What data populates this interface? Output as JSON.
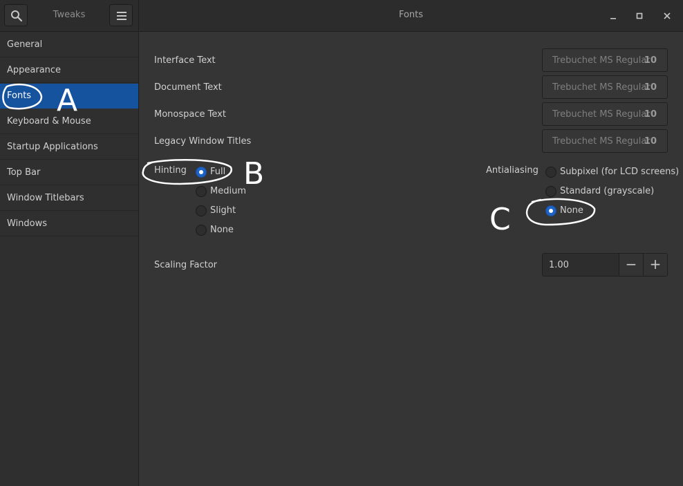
{
  "header": {
    "app_title": "Tweaks",
    "page_title": "Fonts",
    "search_icon": "search-icon",
    "menu_icon": "hamburger-menu-icon",
    "window_controls": [
      "minimize-icon",
      "maximize-icon",
      "close-icon"
    ]
  },
  "sidebar": {
    "items": [
      {
        "label": "General"
      },
      {
        "label": "Appearance"
      },
      {
        "label": "Fonts",
        "selected": true
      },
      {
        "label": "Keyboard & Mouse"
      },
      {
        "label": "Startup Applications"
      },
      {
        "label": "Top Bar"
      },
      {
        "label": "Window Titlebars"
      },
      {
        "label": "Windows"
      }
    ]
  },
  "fonts": {
    "interface": {
      "label": "Interface Text",
      "font": "Trebuchet MS Regular",
      "size": "10"
    },
    "document": {
      "label": "Document Text",
      "font": "Trebuchet MS Regular",
      "size": "10"
    },
    "monospace": {
      "label": "Monospace Text",
      "font": "Trebuchet MS Regular",
      "size": "10"
    },
    "legacy": {
      "label": "Legacy Window Titles",
      "font": "Trebuchet MS Regular",
      "size": "10"
    }
  },
  "hinting": {
    "label": "Hinting",
    "options": [
      "Full",
      "Medium",
      "Slight",
      "None"
    ],
    "selected": "Full"
  },
  "antialiasing": {
    "label": "Antialiasing",
    "options": [
      "Subpixel (for LCD screens)",
      "Standard (grayscale)",
      "None"
    ],
    "selected": "None"
  },
  "scaling": {
    "label": "Scaling Factor",
    "value": "1.00",
    "decrement": "−",
    "increment": "+"
  },
  "annotations": {
    "a": "A",
    "b": "B",
    "c": "C",
    "color": "#ffffff"
  },
  "colors": {
    "accent": "#15539e",
    "radio_checked": "#1d62c5"
  }
}
